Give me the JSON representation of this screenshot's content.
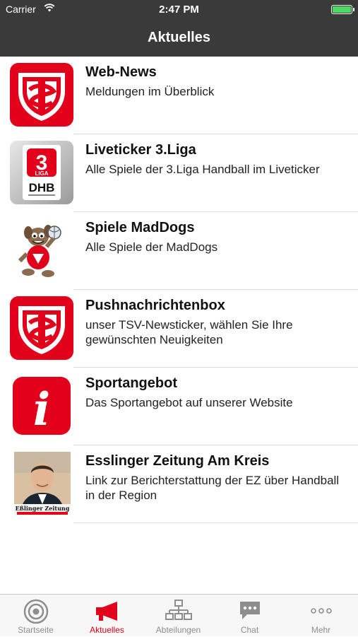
{
  "status": {
    "carrier": "Carrier",
    "time": "2:47 PM"
  },
  "navbar": {
    "title": "Aktuelles"
  },
  "items": [
    {
      "title": "Web-News",
      "subtitle": "Meldungen im Überblick"
    },
    {
      "title": "Liveticker 3.Liga",
      "subtitle": "Alle Spiele der 3.Liga Handball im Liveticker"
    },
    {
      "title": "Spiele MadDogs",
      "subtitle": "Alle Spiele der MadDogs"
    },
    {
      "title": "Pushnachrichtenbox",
      "subtitle": "unser TSV-Newsticker, wählen Sie Ihre gewünschten Neuigkeiten"
    },
    {
      "title": "Sportangebot",
      "subtitle": "Das Sportangebot auf unserer Website"
    },
    {
      "title": "Esslinger Zeitung Am Kreis",
      "subtitle": "Link zur Berichterstattung der EZ über Handball in der Region"
    }
  ],
  "icons": {
    "tsv_logo": "tsv-logo-icon",
    "dhb_logo": "dhb-3liga-logo-icon",
    "mascot": "maddogs-mascot-icon",
    "info": "info-icon",
    "newspaper": "esslinger-zeitung-photo"
  },
  "dhb_text": {
    "number": "3",
    "liga": "LIGA",
    "brand": "DHB"
  },
  "info_letter": "i",
  "newspaper_caption": "Eßlinger Zeitung",
  "tabs": [
    {
      "label": "Startseite",
      "icon": "target-icon",
      "active": false
    },
    {
      "label": "Aktuelles",
      "icon": "megaphone-icon",
      "active": true
    },
    {
      "label": "Abteilungen",
      "icon": "org-chart-icon",
      "active": false
    },
    {
      "label": "Chat",
      "icon": "chat-bubble-icon",
      "active": false
    },
    {
      "label": "Mehr",
      "icon": "more-dots-icon",
      "active": false
    }
  ],
  "colors": {
    "bar": "#3a3a3a",
    "accent": "#e2001a",
    "battery": "#4cd964",
    "inactive_tab": "#8e8e8e"
  }
}
